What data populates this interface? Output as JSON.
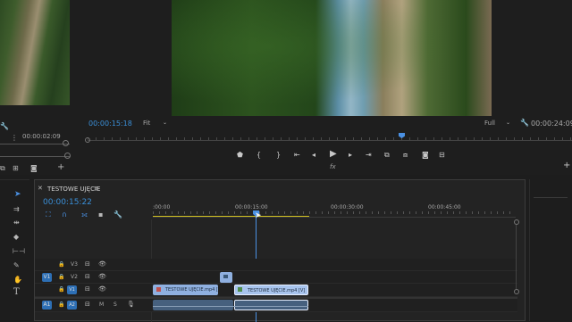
{
  "source_monitor": {
    "timecode": "00:00:02:09"
  },
  "program_monitor": {
    "timecode": "00:00:15:18",
    "fit_label": "Fit",
    "quality_label": "Full",
    "duration": "00:00:24:09",
    "fx_label": "fx"
  },
  "timeline": {
    "sequence_name": "TESTOWE UJĘCIE",
    "menu_glyph": "≡",
    "timecode": "00:00:15:22",
    "ruler_labels": [
      ":00:00",
      "00:00:15:00",
      "00:00:30:00",
      "00:00:45:00"
    ],
    "tracks": [
      {
        "name": "V3",
        "target": ""
      },
      {
        "name": "V2",
        "target": "V1"
      },
      {
        "name": "V1",
        "target": ""
      },
      {
        "name": "A1",
        "target": "A1"
      },
      {
        "name": "A2",
        "target": ""
      }
    ],
    "clips": [
      {
        "label": "TESTOWE UJĘCIE.mp4 [",
        "color": "#8fb0e0"
      },
      {
        "label": "TESTOWE UJĘCIE.mp4 [V]",
        "color": "#a8c4ee"
      }
    ],
    "m_label": "M",
    "s_label": "S"
  },
  "tools": [
    "selection-tool",
    "track-select-tool",
    "ripple-edit-tool",
    "razor-tool",
    "slip-tool",
    "pen-tool",
    "hand-tool",
    "type-tool"
  ],
  "colors": {
    "accent": "#3a8fd8",
    "playhead": "#4a90e2",
    "work_area": "#d0c020",
    "v_clip": "#a8c4ee",
    "a_clip": "#46607e"
  }
}
